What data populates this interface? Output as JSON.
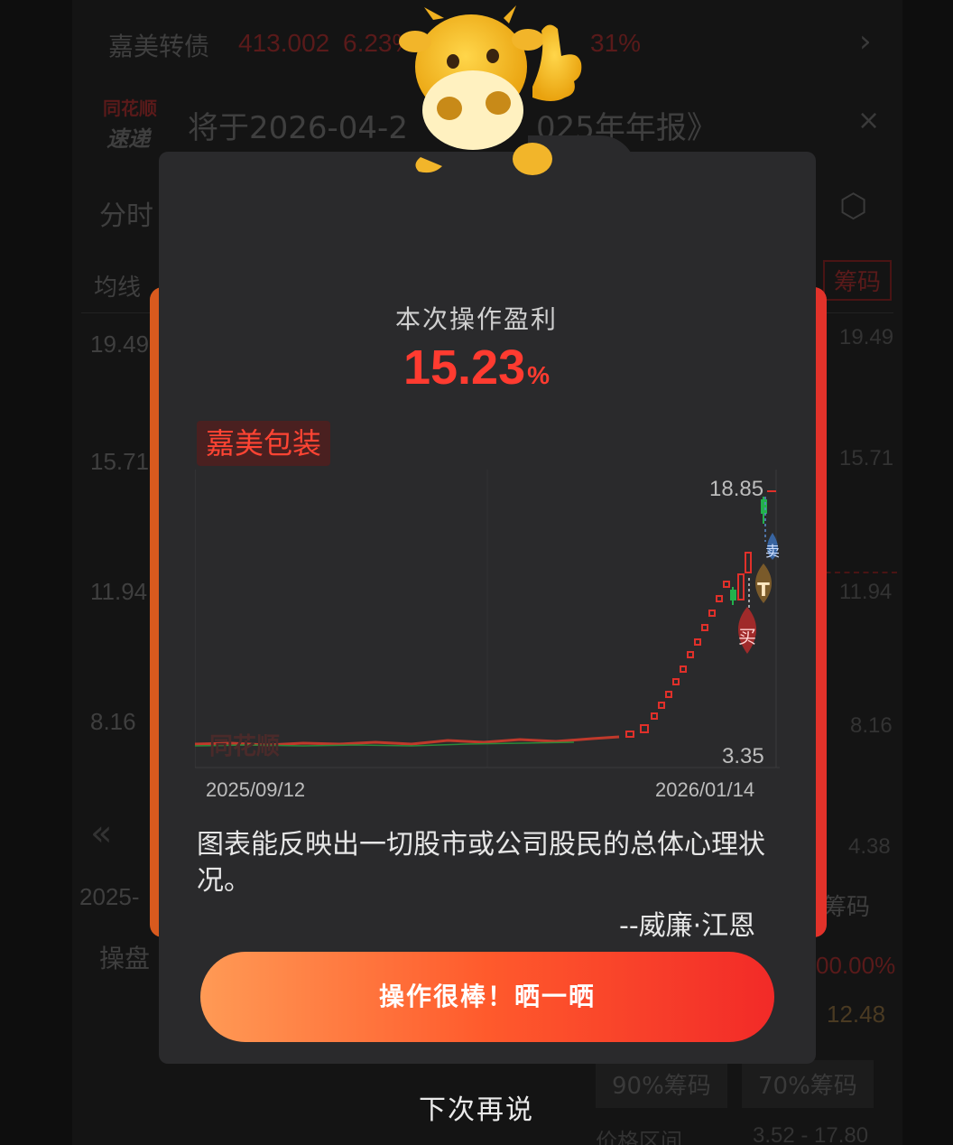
{
  "background": {
    "ticker": {
      "name": "嘉美转债",
      "price": "413.002",
      "change": "6.23%",
      "change_tail": "31%"
    },
    "notice": {
      "brand_top": "同花顺",
      "brand_bottom": "速递",
      "text_left": "将于2026-04-2",
      "text_right": "025年年报》"
    },
    "tab_partial": "分时",
    "ma_label": "均线",
    "chips_tab": "筹码",
    "left_axis": [
      "19.49",
      "15.71",
      "11.94",
      "8.16"
    ],
    "right_axis": [
      "19.49",
      "15.71",
      "11.94",
      "8.16",
      "4.38"
    ],
    "date_partial": "2025-",
    "operate_partial": "操盘",
    "chips_label_partial": "筹码",
    "percent_value": "00.00%",
    "price_value": "12.48",
    "chip_tabs": [
      "90%筹码",
      "70%筹码"
    ],
    "range_label_partial": "价格区间",
    "range_value": "3.52 - 17.80"
  },
  "modal": {
    "profit_label": "本次操作盈利",
    "profit_value": "15.23",
    "profit_unit": "%",
    "stock_name": "嘉美包装",
    "watermark": "同花顺",
    "chart": {
      "price_high": "18.85",
      "price_low": "3.35",
      "date_start": "2025/09/12",
      "date_end": "2026/01/14",
      "markers": {
        "buy": "买",
        "sell": "卖",
        "t": "T"
      }
    },
    "quote": "图表能反映出一切股市或公司股民的总体心理状况。",
    "author": "--威廉·江恩",
    "share_button": "操作很棒！晒一晒",
    "dismiss": "下次再说"
  },
  "colors": {
    "up": "#ff3b30",
    "down": "#22b14c",
    "accent": "#ff5a2c"
  }
}
